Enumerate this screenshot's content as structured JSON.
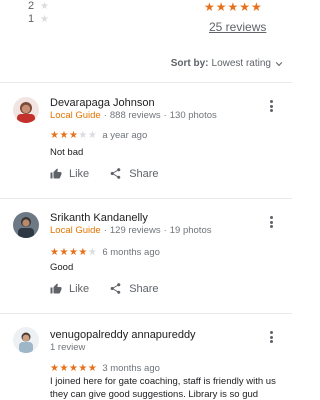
{
  "histogram": [
    {
      "label": "2"
    },
    {
      "label": "1"
    }
  ],
  "summary": {
    "stars": "★★★★★",
    "reviews_link": "25 reviews"
  },
  "sort": {
    "label": "Sort by:",
    "value": "Lowest rating"
  },
  "actions": {
    "like": "Like",
    "share": "Share"
  },
  "reviews": [
    {
      "name": "Devarapaga Johnson",
      "guide": "Local Guide",
      "reviews": "888 reviews",
      "photos": "130 photos",
      "rating": 3,
      "time": "a year ago",
      "text": "Not bad"
    },
    {
      "name": "Srikanth Kandanelly",
      "guide": "Local Guide",
      "reviews": "129 reviews",
      "photos": "19 photos",
      "rating": 4,
      "time": "6 months ago",
      "text": "Good"
    },
    {
      "name": "venugopalreddy annapureddy",
      "reviews": "1 review",
      "rating": 5,
      "time": "3 months ago",
      "text": "I joined here for gate coaching, staff is friendly with us they can give good suggestions. Library is so gud"
    }
  ],
  "colors": {
    "star_on": "#e7711b",
    "star_off": "#dadce0",
    "local_guide": "#e37400",
    "divider": "#e8eaed"
  }
}
